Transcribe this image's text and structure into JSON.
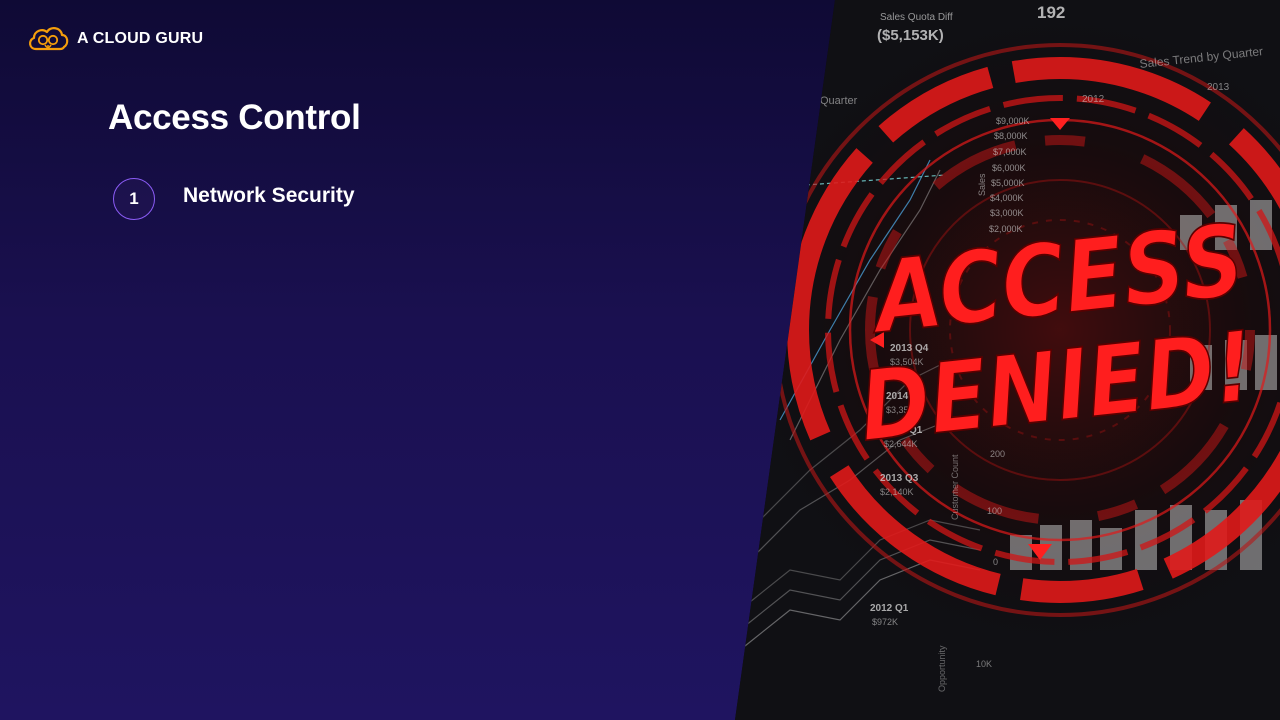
{
  "brand": {
    "name": "A CLOUD GURU",
    "logo_icon": "cloud-face-icon",
    "logo_color": "#f59e0b"
  },
  "slide": {
    "title": "Access Control",
    "agenda": [
      {
        "number": "1",
        "label": "Network Security"
      }
    ]
  },
  "photo": {
    "headline_line1": "ACCESS",
    "headline_line2": "DENIED!",
    "accent_color": "#e01a1a",
    "dashboard": {
      "quota_label": "Sales Quota Diff",
      "quota_value": "($5,153K)",
      "top_number": "192",
      "trend_label": "Sales Trend by Quarter",
      "quarter_label": "Quarter",
      "year_labels": [
        "2012",
        "2013"
      ],
      "sales_axis_label": "Sales",
      "sales_ticks": [
        "$9,000K",
        "$8,000K",
        "$7,000K",
        "$6,000K",
        "$5,000K",
        "$4,000K",
        "$3,000K",
        "$2,000K"
      ],
      "quarter_items": [
        {
          "q": "2013 Q4",
          "v": "$3,504K"
        },
        {
          "q": "2014 Q2",
          "v": "$3,358K"
        },
        {
          "q": "2014 Q1",
          "v": "$2,644K"
        },
        {
          "q": "2013 Q3",
          "v": "$2,140K"
        },
        {
          "q": "2012 Q1",
          "v": "$972K"
        }
      ],
      "customer_axis_label": "Customer Count",
      "customer_ticks": [
        "200",
        "100",
        "0"
      ],
      "opportunity_label": "Opportunity",
      "opportunity_tick": "10K"
    }
  }
}
